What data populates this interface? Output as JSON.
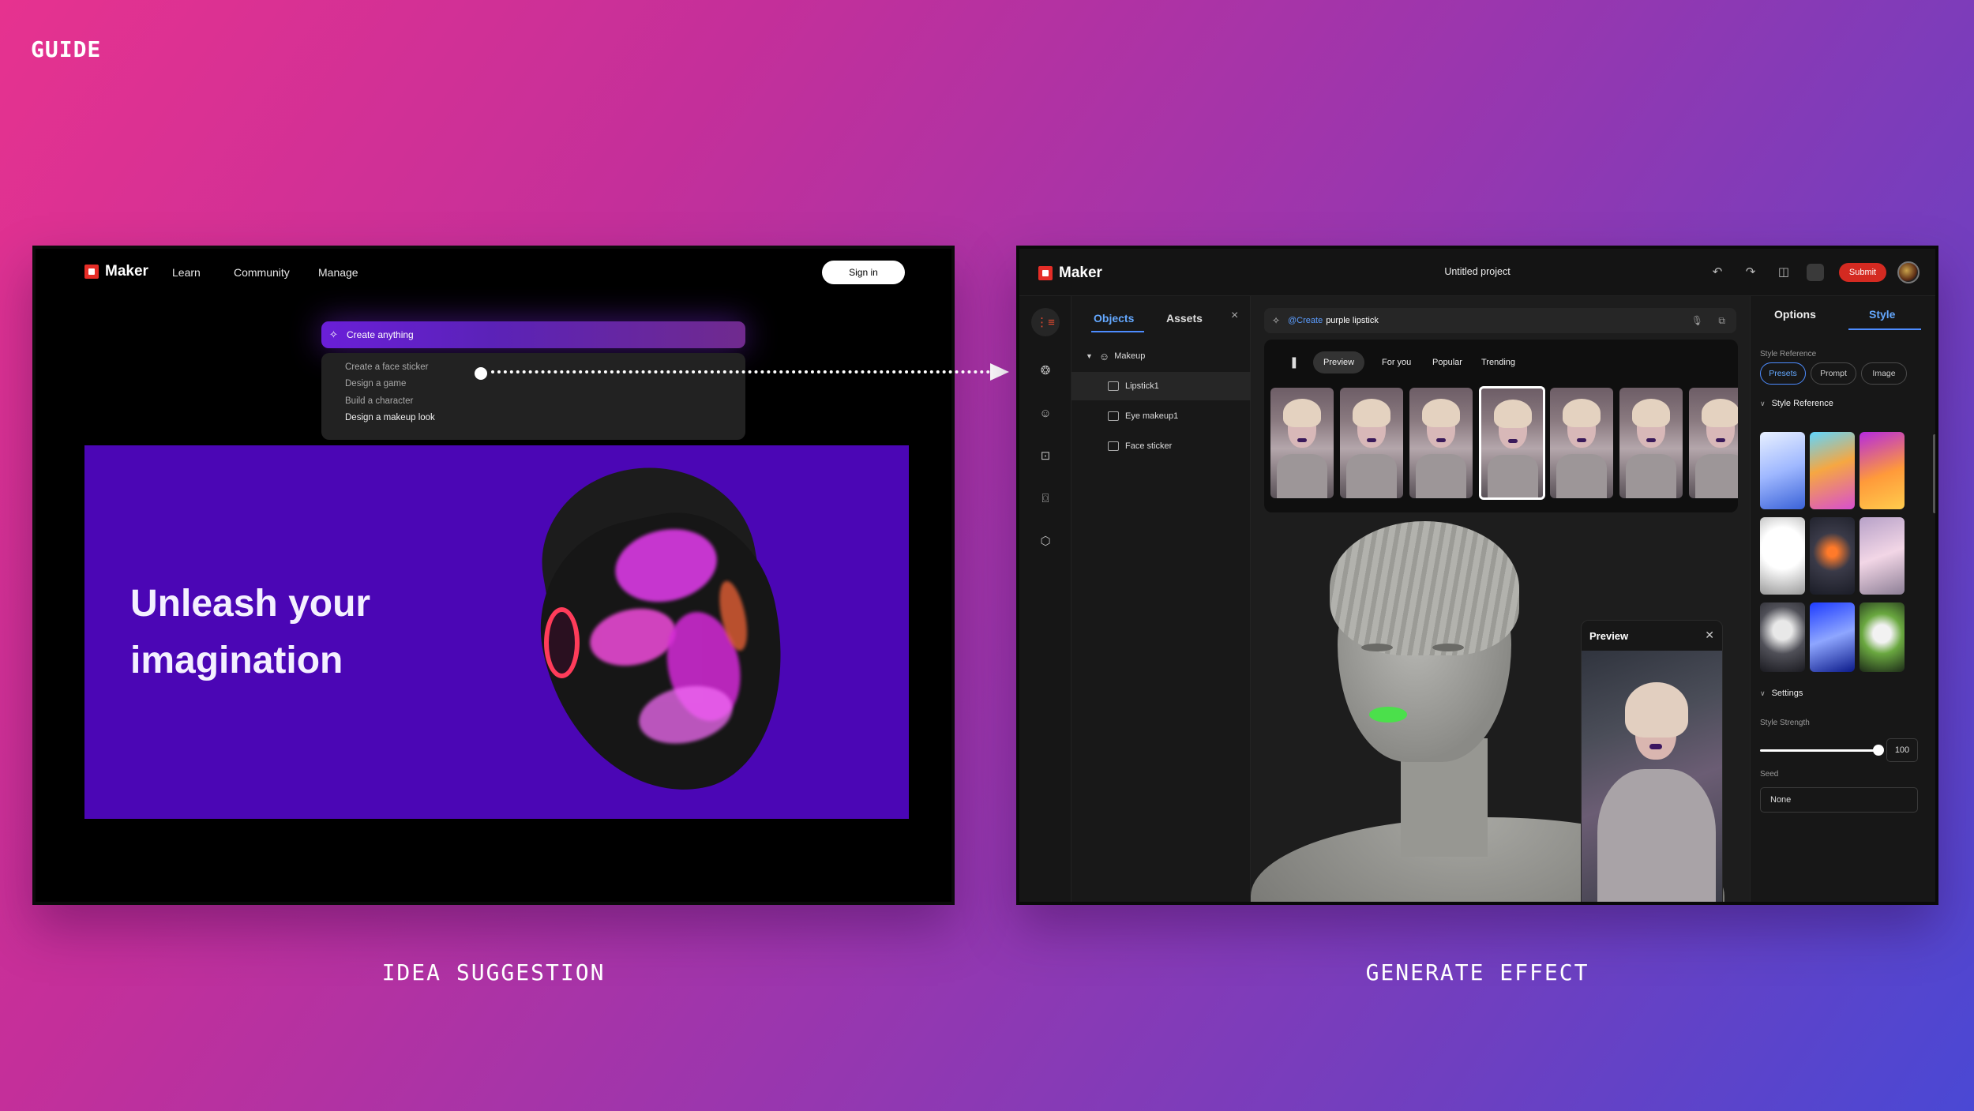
{
  "page": {
    "guide_label": "GUIDE",
    "captions": {
      "left": "IDEA SUGGESTION",
      "right": "GENERATE EFFECT"
    }
  },
  "brand": {
    "name": "Maker",
    "accent": "#e52d27"
  },
  "window1": {
    "nav": {
      "learn": "Learn",
      "community": "Community",
      "manage": "Manage",
      "sign_in": "Sign in"
    },
    "create_bar": {
      "placeholder": "Create anything",
      "icon": "sparkle-icon"
    },
    "suggestions": [
      "Create a face sticker",
      "Design a game",
      "Build a character",
      "Design a makeup look"
    ],
    "suggestion_active_index": 3,
    "hero": {
      "line1": "Unleash your",
      "line2": "imagination",
      "bg": "#4b06b5"
    }
  },
  "window2": {
    "title": "Untitled project",
    "toolbar": {
      "submit": "Submit",
      "icons": [
        "undo-icon",
        "redo-icon",
        "layout-icon",
        "phone-icon"
      ]
    },
    "rail_icons": [
      "hierarchy-icon",
      "effects-icon",
      "face-icon",
      "face-tracking-icon",
      "camera-frame-icon",
      "cube-icon"
    ],
    "objects_panel": {
      "tabs": [
        "Objects",
        "Assets"
      ],
      "active_tab": "Objects",
      "tree": {
        "root": "Makeup",
        "children": [
          "Lipstick1",
          "Eye makeup1",
          "Face sticker"
        ],
        "selected": "Lipstick1"
      }
    },
    "prompt": {
      "mention": "@Create",
      "text": "purple lipstick"
    },
    "gallery": {
      "filters": [
        "Preview",
        "For you",
        "Popular",
        "Trending"
      ],
      "active_filter": "Preview",
      "selected_thumb_index": 3,
      "thumb_count": 7
    },
    "preview": {
      "title": "Preview"
    },
    "right_panel": {
      "tabs": [
        "Options",
        "Style"
      ],
      "active_tab": "Style",
      "style_reference_label": "Style Reference",
      "ref_modes": [
        "Presets",
        "Prompt",
        "Image"
      ],
      "active_mode": "Presets",
      "style_reference_section": "Style Reference",
      "settings_section": "Settings",
      "style_strength_label": "Style Strength",
      "style_strength_value": "100",
      "seed_label": "Seed",
      "seed_value": "None"
    }
  }
}
